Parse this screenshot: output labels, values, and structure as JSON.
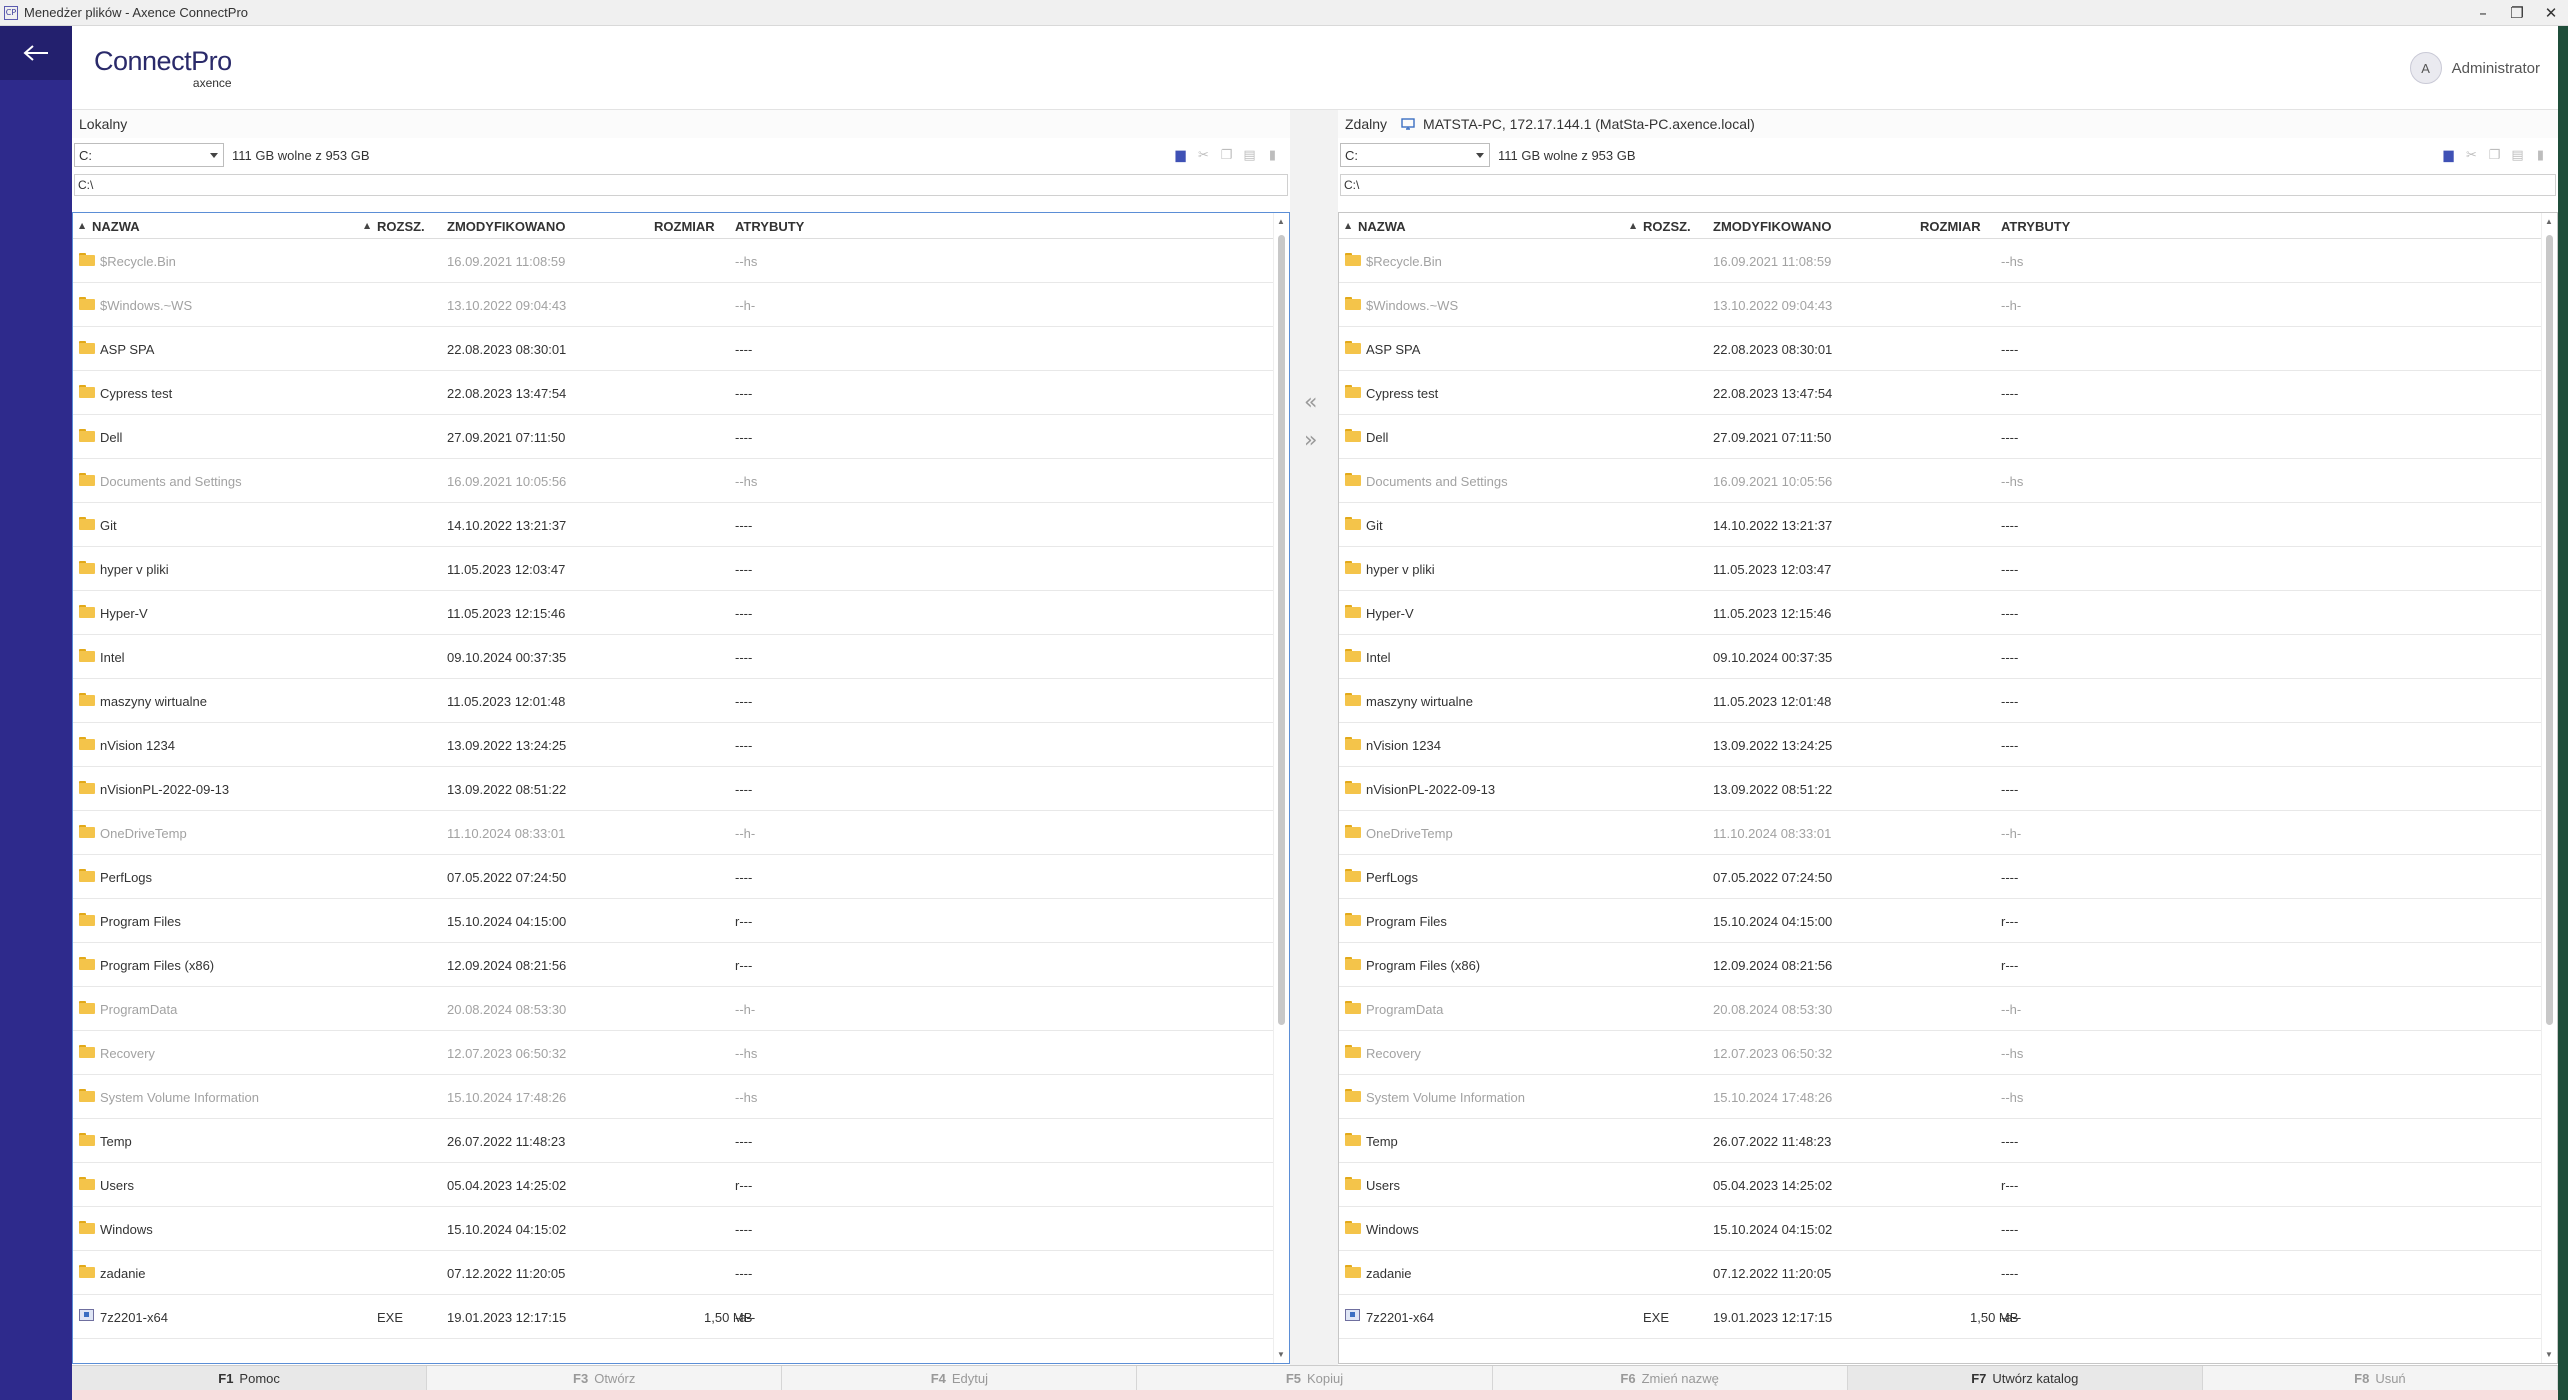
{
  "window": {
    "title": "Menedżer plików - Axence ConnectPro",
    "controls": [
      "–",
      "❐",
      "✕"
    ]
  },
  "header": {
    "logo_main": "ConnectPro",
    "logo_sub": "axence",
    "user_initial": "A",
    "user_name": "Administrator"
  },
  "left": {
    "label": "Lokalny",
    "drive": "C:",
    "free": "111 GB wolne z 953 GB",
    "path": "C:\\"
  },
  "right": {
    "label": "Zdalny",
    "computer": "MATSTA-PC, 172.17.144.1 (MatSta-PC.axence.local)",
    "drive": "C:",
    "free": "111 GB wolne z 953 GB",
    "path": "C:\\"
  },
  "columns": {
    "name": "NAZWA",
    "ext": "ROZSZ.",
    "modified": "ZMODYFIKOWANO",
    "size": "ROZMIAR",
    "attrs": "ATRYBUTY"
  },
  "files": [
    {
      "name": "$Recycle.Bin",
      "ext": "",
      "modified": "16.09.2021 11:08:59",
      "size": "",
      "attrs": "--hs",
      "hidden": true,
      "type": "folder"
    },
    {
      "name": "$Windows.~WS",
      "ext": "",
      "modified": "13.10.2022 09:04:43",
      "size": "",
      "attrs": "--h-",
      "hidden": true,
      "type": "folder"
    },
    {
      "name": "ASP SPA",
      "ext": "",
      "modified": "22.08.2023 08:30:01",
      "size": "",
      "attrs": "----",
      "hidden": false,
      "type": "folder"
    },
    {
      "name": "Cypress test",
      "ext": "",
      "modified": "22.08.2023 13:47:54",
      "size": "",
      "attrs": "----",
      "hidden": false,
      "type": "folder"
    },
    {
      "name": "Dell",
      "ext": "",
      "modified": "27.09.2021 07:11:50",
      "size": "",
      "attrs": "----",
      "hidden": false,
      "type": "folder"
    },
    {
      "name": "Documents and Settings",
      "ext": "",
      "modified": "16.09.2021 10:05:56",
      "size": "",
      "attrs": "--hs",
      "hidden": true,
      "type": "folder"
    },
    {
      "name": "Git",
      "ext": "",
      "modified": "14.10.2022 13:21:37",
      "size": "",
      "attrs": "----",
      "hidden": false,
      "type": "folder"
    },
    {
      "name": "hyper v pliki",
      "ext": "",
      "modified": "11.05.2023 12:03:47",
      "size": "",
      "attrs": "----",
      "hidden": false,
      "type": "folder"
    },
    {
      "name": "Hyper-V",
      "ext": "",
      "modified": "11.05.2023 12:15:46",
      "size": "",
      "attrs": "----",
      "hidden": false,
      "type": "folder"
    },
    {
      "name": "Intel",
      "ext": "",
      "modified": "09.10.2024 00:37:35",
      "size": "",
      "attrs": "----",
      "hidden": false,
      "type": "folder"
    },
    {
      "name": "maszyny wirtualne",
      "ext": "",
      "modified": "11.05.2023 12:01:48",
      "size": "",
      "attrs": "----",
      "hidden": false,
      "type": "folder"
    },
    {
      "name": "nVision 1234",
      "ext": "",
      "modified": "13.09.2022 13:24:25",
      "size": "",
      "attrs": "----",
      "hidden": false,
      "type": "folder"
    },
    {
      "name": "nVisionPL-2022-09-13",
      "ext": "",
      "modified": "13.09.2022 08:51:22",
      "size": "",
      "attrs": "----",
      "hidden": false,
      "type": "folder"
    },
    {
      "name": "OneDriveTemp",
      "ext": "",
      "modified": "11.10.2024 08:33:01",
      "size": "",
      "attrs": "--h-",
      "hidden": true,
      "type": "folder"
    },
    {
      "name": "PerfLogs",
      "ext": "",
      "modified": "07.05.2022 07:24:50",
      "size": "",
      "attrs": "----",
      "hidden": false,
      "type": "folder"
    },
    {
      "name": "Program Files",
      "ext": "",
      "modified": "15.10.2024 04:15:00",
      "size": "",
      "attrs": "r---",
      "hidden": false,
      "type": "folder"
    },
    {
      "name": "Program Files (x86)",
      "ext": "",
      "modified": "12.09.2024 08:21:56",
      "size": "",
      "attrs": "r---",
      "hidden": false,
      "type": "folder"
    },
    {
      "name": "ProgramData",
      "ext": "",
      "modified": "20.08.2024 08:53:30",
      "size": "",
      "attrs": "--h-",
      "hidden": true,
      "type": "folder"
    },
    {
      "name": "Recovery",
      "ext": "",
      "modified": "12.07.2023 06:50:32",
      "size": "",
      "attrs": "--hs",
      "hidden": true,
      "type": "folder"
    },
    {
      "name": "System Volume Information",
      "ext": "",
      "modified": "15.10.2024 17:48:26",
      "size": "",
      "attrs": "--hs",
      "hidden": true,
      "type": "folder"
    },
    {
      "name": "Temp",
      "ext": "",
      "modified": "26.07.2022 11:48:23",
      "size": "",
      "attrs": "----",
      "hidden": false,
      "type": "folder"
    },
    {
      "name": "Users",
      "ext": "",
      "modified": "05.04.2023 14:25:02",
      "size": "",
      "attrs": "r---",
      "hidden": false,
      "type": "folder"
    },
    {
      "name": "Windows",
      "ext": "",
      "modified": "15.10.2024 04:15:02",
      "size": "",
      "attrs": "----",
      "hidden": false,
      "type": "folder"
    },
    {
      "name": "zadanie",
      "ext": "",
      "modified": "07.12.2022 11:20:05",
      "size": "",
      "attrs": "----",
      "hidden": false,
      "type": "folder"
    },
    {
      "name": "7z2201-x64",
      "ext": "EXE",
      "modified": "19.01.2023 12:17:15",
      "size": "1,50 MB",
      "attrs": "-a--",
      "hidden": false,
      "type": "exe"
    }
  ],
  "fkeys": [
    {
      "key": "F1",
      "label": "Pomoc",
      "enabled": true
    },
    {
      "key": "F3",
      "label": "Otwórz",
      "enabled": false
    },
    {
      "key": "F4",
      "label": "Edytuj",
      "enabled": false
    },
    {
      "key": "F5",
      "label": "Kopiuj",
      "enabled": false
    },
    {
      "key": "F6",
      "label": "Zmień nazwę",
      "enabled": false
    },
    {
      "key": "F7",
      "label": "Utwórz katalog",
      "enabled": true
    },
    {
      "key": "F8",
      "label": "Usuń",
      "enabled": false
    }
  ],
  "colors": {
    "sidebar": "#2e2a8c",
    "accent": "#3f51b5",
    "folder": "#f4c44a",
    "hidden_text": "#a2a2a2"
  }
}
